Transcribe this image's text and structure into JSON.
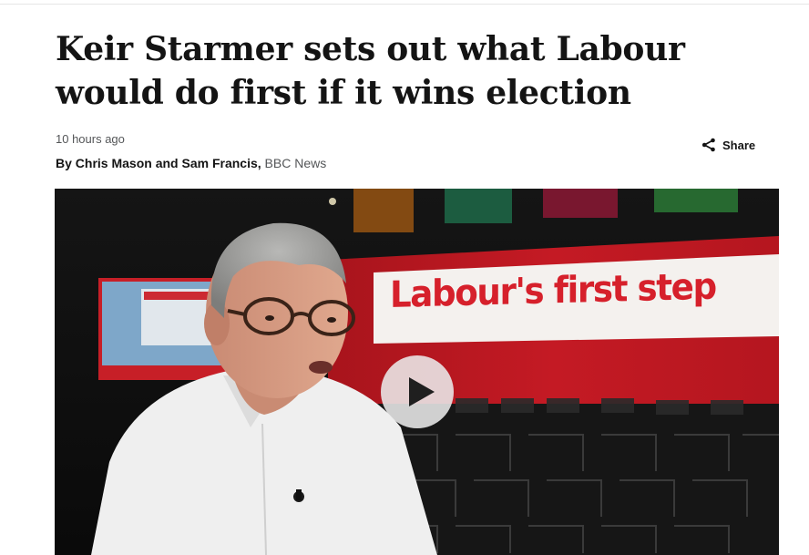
{
  "article": {
    "headline": "Keir Starmer sets out what Labour would do first if it wins election",
    "timestamp": "10 hours ago",
    "byline_prefix": "By ",
    "authors": "Chris Mason and Sam Francis,",
    "outlet": "BBC News"
  },
  "share": {
    "label": "Share",
    "icon": "share-icon"
  },
  "media": {
    "banner_text": "Labour's first step",
    "play_icon": "play-icon"
  },
  "colors": {
    "headline": "#141414",
    "meta_grey": "#545658",
    "labour_red": "#d6202b",
    "play_button_bg": "#ebebeb"
  }
}
